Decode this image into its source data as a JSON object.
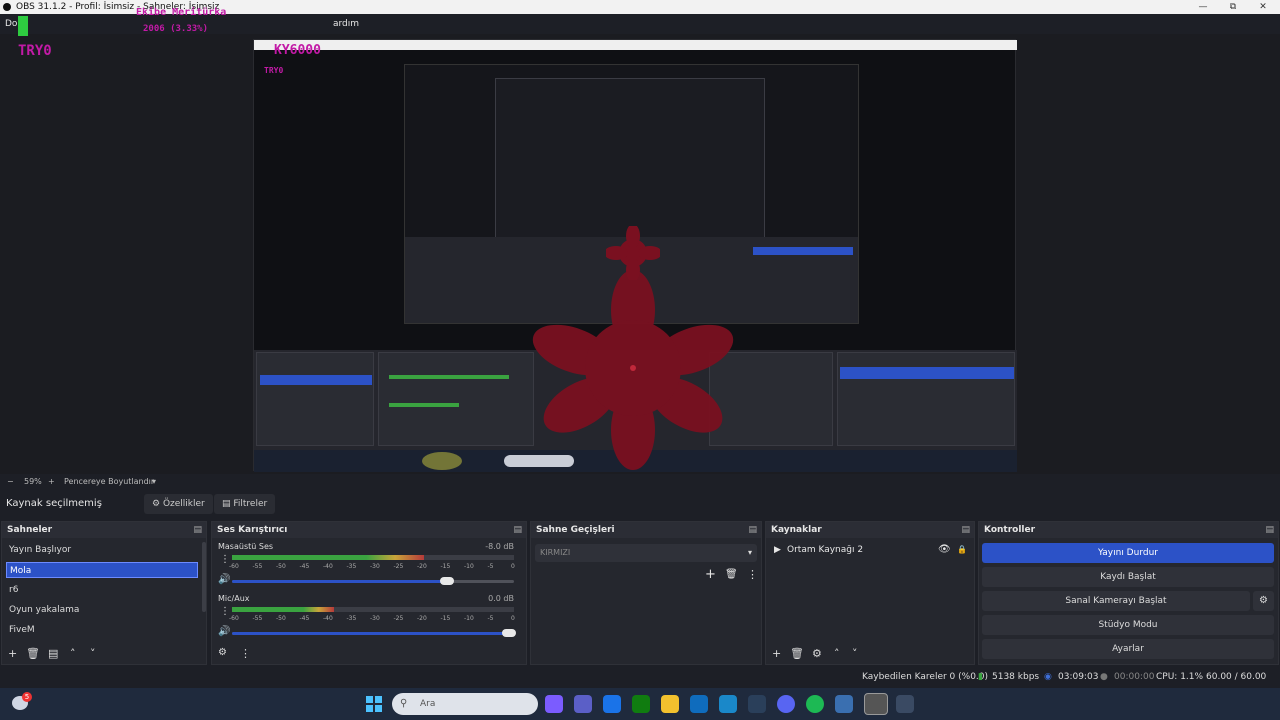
{
  "window": {
    "title": "OBS 31.1.2 - Profil: İsimsiz - Sahneler: İsimsiz",
    "menu_left": "Do",
    "menu_right": "ardım"
  },
  "overlay": {
    "alert_title": "Ekibe Meritürka",
    "alert_value": "2006 (3.33%)",
    "tag": "TRY0",
    "inner_big": "KY6000"
  },
  "preview": {
    "zoom": "59%",
    "zoom_mode": "Pencereye Boyutlandır"
  },
  "source_toolbar": {
    "label": "Kaynak seçilmemiş",
    "properties": "Özellikler",
    "filters": "Filtreler"
  },
  "docks": {
    "scenes": {
      "title": "Sahneler",
      "items": [
        "Yayın Başlıyor",
        "Mola",
        "r6",
        "Oyun yakalama",
        "FiveM"
      ],
      "selected_index": 1
    },
    "mixer": {
      "title": "Ses Karıştırıcı",
      "channels": [
        {
          "name": "Masaüstü Ses",
          "db": "-8.0 dB",
          "level": 0.68,
          "volume": 0.78
        },
        {
          "name": "Mic/Aux",
          "db": "0.0 dB",
          "level": 0.36,
          "volume": 1.0
        }
      ],
      "scale": [
        "-60",
        "-55",
        "-50",
        "-45",
        "-40",
        "-35",
        "-30",
        "-25",
        "-20",
        "-15",
        "-10",
        "-5",
        "0"
      ]
    },
    "transitions": {
      "title": "Sahne Geçişleri",
      "selected": "KIRMIZI"
    },
    "sources": {
      "title": "Kaynaklar",
      "items": [
        "Ortam Kaynağı 2"
      ]
    },
    "controls": {
      "title": "Kontroller",
      "buttons": [
        "Yayını Durdur",
        "Kaydı Başlat",
        "Sanal Kamerayı Başlat",
        "Stüdyo Modu",
        "Ayarlar"
      ]
    }
  },
  "status": {
    "dropped": "Kaybedilen Kareler 0 (%0.0)",
    "bitrate": "5138 kbps",
    "stream_time": "03:09:03",
    "rec_time": "00:00:00",
    "cpu": "CPU: 1.1%",
    "fps": "60.00 / 60.00 FPS"
  },
  "taskbar": {
    "search": "Ara",
    "notification_count": "5"
  },
  "colors": {
    "accent": "#2c52c7",
    "overlay": "#c21aa6",
    "flower": "#7a1020"
  }
}
